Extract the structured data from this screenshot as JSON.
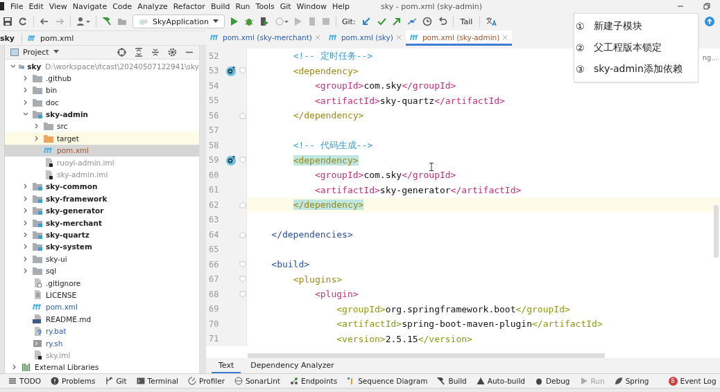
{
  "menu": [
    "File",
    "Edit",
    "View",
    "Navigate",
    "Code",
    "Analyze",
    "Refactor",
    "Build",
    "Run",
    "Tools",
    "Git",
    "Window",
    "Help"
  ],
  "window": {
    "title": "sky - pom.xml (sky-admin)"
  },
  "toolbar": {
    "run_config": "SkyApplication",
    "git_label": "Git:",
    "tail": "Tail"
  },
  "breadcrumb": [
    "sky",
    "pom.xml"
  ],
  "project_panel": {
    "title": "Project"
  },
  "tabs": [
    {
      "label": "pom.xml (sky-merchant)",
      "selected": false,
      "color": "#2a5cb8"
    },
    {
      "label": "pom.xml (sky)",
      "selected": false,
      "color": "#2a5cb8"
    },
    {
      "label": "pom.xml (sky-admin)",
      "selected": true,
      "color": "#a0522d"
    }
  ],
  "tree": [
    {
      "name": "sky",
      "path": "D:\\workspace\\itcast\\20240507122941\\sky",
      "kind": "module",
      "bold": true,
      "expanded": true,
      "selected": false,
      "children": [
        {
          "name": ".github",
          "kind": "folder",
          "expanded": false,
          "selected": false
        },
        {
          "name": "bin",
          "kind": "folder",
          "expanded": false,
          "selected": false
        },
        {
          "name": "doc",
          "kind": "folder",
          "expanded": false,
          "selected": false
        },
        {
          "name": "sky-admin",
          "kind": "module",
          "bold": true,
          "expanded": true,
          "selected": false,
          "children": [
            {
              "name": "src",
              "kind": "folder",
              "expanded": false,
              "selected": false
            },
            {
              "name": "target",
              "kind": "excluded",
              "expanded": false,
              "selected": false,
              "highlighted": true
            },
            {
              "name": "pom.xml",
              "kind": "maven",
              "color": "#a0522d",
              "selected": true
            },
            {
              "name": "ruoyi-admin.iml",
              "kind": "iml",
              "color": "#909090",
              "selected": false
            },
            {
              "name": "sky-admin.iml",
              "kind": "iml",
              "color": "#909090",
              "selected": false
            }
          ]
        },
        {
          "name": "sky-common",
          "kind": "module",
          "bold": true,
          "expanded": false,
          "selected": false
        },
        {
          "name": "sky-framework",
          "kind": "module",
          "bold": true,
          "expanded": false,
          "selected": false
        },
        {
          "name": "sky-generator",
          "kind": "module",
          "bold": true,
          "expanded": false,
          "selected": false
        },
        {
          "name": "sky-merchant",
          "kind": "module",
          "bold": true,
          "expanded": false,
          "selected": false
        },
        {
          "name": "sky-quartz",
          "kind": "module",
          "bold": true,
          "expanded": false,
          "selected": false
        },
        {
          "name": "sky-system",
          "kind": "module",
          "bold": true,
          "expanded": false,
          "selected": false
        },
        {
          "name": "sky-ui",
          "kind": "folder",
          "expanded": false,
          "selected": false
        },
        {
          "name": "sql",
          "kind": "folder",
          "expanded": false,
          "selected": false
        },
        {
          "name": ".gitignore",
          "kind": "gitignore",
          "selected": false
        },
        {
          "name": "LICENSE",
          "kind": "text",
          "selected": false
        },
        {
          "name": "pom.xml",
          "kind": "maven",
          "color": "#2a5cb8",
          "selected": false
        },
        {
          "name": "README.md",
          "kind": "markdown",
          "selected": false
        },
        {
          "name": "ry.bat",
          "kind": "bat",
          "color": "#2a5cb8",
          "selected": false
        },
        {
          "name": "ry.sh",
          "kind": "shell",
          "color": "#2a5cb8",
          "selected": false
        },
        {
          "name": "sky.iml",
          "kind": "iml",
          "color": "#909090",
          "selected": false
        }
      ]
    },
    {
      "name": "External Libraries",
      "kind": "libraries",
      "expanded": false,
      "selected": false
    }
  ],
  "editor": {
    "inspection": "ng...",
    "lines": [
      {
        "number": "52",
        "tokens": [
          {
            "kind": "comment",
            "text": "        <!-- 定时任务-->"
          }
        ]
      },
      {
        "number": "53",
        "marker": true,
        "fold_open": true,
        "tokens": [
          {
            "kind": "tag-mid",
            "text": "        <dependency>"
          }
        ]
      },
      {
        "number": "54",
        "tokens": [
          {
            "kind": "tag-inner",
            "text": "            <groupId>"
          },
          {
            "kind": "text",
            "text": "com.sky"
          },
          {
            "kind": "tag-inner",
            "text": "</groupId>"
          }
        ]
      },
      {
        "number": "55",
        "tokens": [
          {
            "kind": "tag-inner",
            "text": "            <artifactId>"
          },
          {
            "kind": "text",
            "text": "sky-quartz"
          },
          {
            "kind": "tag-inner",
            "text": "</artifactId>"
          }
        ]
      },
      {
        "number": "56",
        "fold_close": true,
        "tokens": [
          {
            "kind": "tag-mid",
            "text": "        </dependency>"
          }
        ]
      },
      {
        "number": "57"
      },
      {
        "number": "58",
        "tokens": [
          {
            "kind": "comment",
            "text": "        <!-- 代码生成-->"
          }
        ]
      },
      {
        "number": "59",
        "marker": true,
        "fold_open": true,
        "tokens": [
          {
            "kind": "tag-mid",
            "text": "        <dependency>",
            "matched": true
          }
        ]
      },
      {
        "number": "60",
        "tokens": [
          {
            "kind": "tag-inner",
            "text": "            <groupId>"
          },
          {
            "kind": "text",
            "text": "com.sky"
          },
          {
            "kind": "tag-inner",
            "text": "</groupId>"
          }
        ]
      },
      {
        "number": "61",
        "tokens": [
          {
            "kind": "tag-inner",
            "text": "            <artifactId>"
          },
          {
            "kind": "text",
            "text": "sky-generator"
          },
          {
            "kind": "tag-inner",
            "text": "</artifactId>"
          }
        ]
      },
      {
        "number": "62",
        "current": true,
        "fold_close": true,
        "tokens": [
          {
            "kind": "tag-mid",
            "text": "        </dependency>",
            "matched": true
          }
        ]
      },
      {
        "number": "63"
      },
      {
        "number": "64",
        "fold_close": true,
        "tokens": [
          {
            "kind": "tag-outer",
            "text": "    </dependencies>"
          }
        ]
      },
      {
        "number": "65"
      },
      {
        "number": "66",
        "fold_open": true,
        "tokens": [
          {
            "kind": "tag-outer",
            "text": "    <build>"
          }
        ]
      },
      {
        "number": "67",
        "fold_open": true,
        "tokens": [
          {
            "kind": "tag-mid",
            "text": "        <plugins>"
          }
        ]
      },
      {
        "number": "68",
        "fold_open": true,
        "tokens": [
          {
            "kind": "tag-inner",
            "text": "            <plugin>"
          }
        ]
      },
      {
        "number": "69",
        "tokens": [
          {
            "kind": "tag-deep",
            "text": "                <groupId>"
          },
          {
            "kind": "text",
            "text": "org.springframework.boot"
          },
          {
            "kind": "tag-deep",
            "text": "</groupId>"
          }
        ]
      },
      {
        "number": "70",
        "tokens": [
          {
            "kind": "tag-deep",
            "text": "                <artifactId>"
          },
          {
            "kind": "text",
            "text": "spring-boot-maven-plugin"
          },
          {
            "kind": "tag-deep",
            "text": "</artifactId>"
          }
        ]
      },
      {
        "number": "71",
        "tokens": [
          {
            "kind": "tag-deep",
            "text": "                <version>"
          },
          {
            "kind": "text",
            "text": "2.5.15"
          },
          {
            "kind": "tag-deep",
            "text": "</version>"
          }
        ]
      }
    ]
  },
  "editor_tabs": [
    {
      "label": "Text",
      "selected": true
    },
    {
      "label": "Dependency Analyzer",
      "selected": false
    }
  ],
  "tool_windows": [
    {
      "label": "TODO",
      "kind": "todo",
      "disabled": false
    },
    {
      "label": "Problems",
      "kind": "problems",
      "disabled": false
    },
    {
      "label": "Git",
      "kind": "git",
      "disabled": false
    },
    {
      "label": "Terminal",
      "kind": "terminal",
      "disabled": false
    },
    {
      "label": "Profiler",
      "kind": "profiler",
      "disabled": false
    },
    {
      "label": "SonarLint",
      "kind": "sonar",
      "disabled": false
    },
    {
      "label": "Endpoints",
      "kind": "endpoints",
      "disabled": false
    },
    {
      "label": "Sequence Diagram",
      "kind": "sequence",
      "disabled": false
    },
    {
      "label": "Build",
      "kind": "build",
      "disabled": false
    },
    {
      "label": "Auto-build",
      "kind": "autobuild",
      "disabled": false
    },
    {
      "label": "Debug",
      "kind": "debug",
      "disabled": false
    },
    {
      "label": "Run",
      "kind": "run",
      "disabled": true
    },
    {
      "label": "Spring",
      "kind": "spring",
      "disabled": false
    }
  ],
  "event_log": {
    "label": "Event Log",
    "count": "8"
  },
  "overlay": [
    {
      "mark": "①",
      "text": "新建子模块"
    },
    {
      "mark": "②",
      "text": "父工程版本锁定"
    },
    {
      "mark": "③",
      "text": "sky-admin添加依赖"
    }
  ]
}
